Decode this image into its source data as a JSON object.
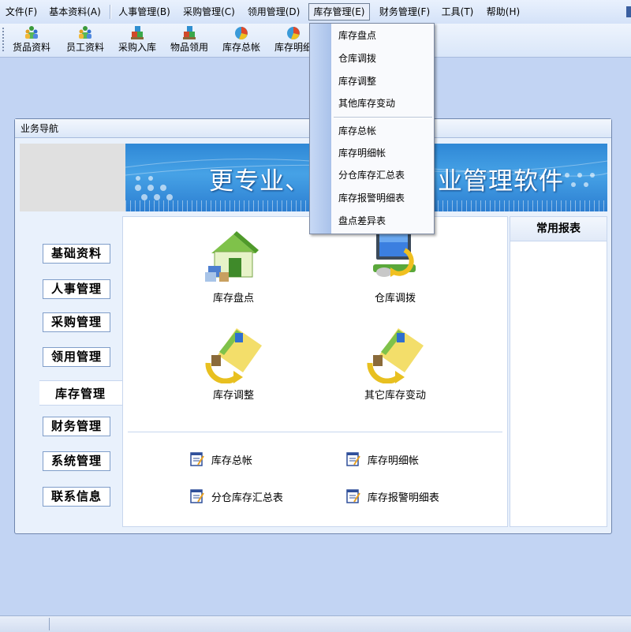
{
  "menubar": {
    "items": [
      {
        "label": "文件(F)"
      },
      {
        "label": "基本资料(A)"
      },
      {
        "label": "人事管理(B)"
      },
      {
        "label": "采购管理(C)"
      },
      {
        "label": "领用管理(D)"
      },
      {
        "label": "库存管理(E)"
      },
      {
        "label": "财务管理(F)"
      },
      {
        "label": "工具(T)"
      },
      {
        "label": "帮助(H)"
      }
    ]
  },
  "toolbar": {
    "buttons": [
      {
        "label": "货品资料",
        "icon": "people-icon"
      },
      {
        "label": "员工资料",
        "icon": "people-icon"
      },
      {
        "label": "采购入库",
        "icon": "boxes-icon"
      },
      {
        "label": "物品领用",
        "icon": "boxes-icon"
      },
      {
        "label": "库存总帐",
        "icon": "pie-chart-icon"
      },
      {
        "label": "库存明细",
        "icon": "pie-chart-icon"
      }
    ]
  },
  "dropdown": {
    "items": [
      {
        "label": "库存盘点"
      },
      {
        "label": "仓库调拨"
      },
      {
        "label": "库存调整"
      },
      {
        "label": "其他库存变动"
      },
      {
        "label": "库存总帐"
      },
      {
        "label": "库存明细帐"
      },
      {
        "label": "分仓库存汇总表"
      },
      {
        "label": "库存报警明细表"
      },
      {
        "label": "盘点差异表"
      }
    ]
  },
  "panel": {
    "title": "业务导航",
    "banner_text_left": "更专业、",
    "banner_text_right": "业管理软件"
  },
  "categories": [
    {
      "label": "基础资料"
    },
    {
      "label": "人事管理"
    },
    {
      "label": "采购管理"
    },
    {
      "label": "领用管理"
    },
    {
      "label": "库存管理"
    },
    {
      "label": "财务管理"
    },
    {
      "label": "系统管理"
    },
    {
      "label": "联系信息"
    }
  ],
  "main_items": [
    {
      "label": "库存盘点",
      "icon": "warehouse-icon"
    },
    {
      "label": "仓库调拨",
      "icon": "computer-transfer-icon"
    },
    {
      "label": "库存调整",
      "icon": "folder-arrow-icon"
    },
    {
      "label": "其它库存变动",
      "icon": "folder-arrow-icon"
    }
  ],
  "reports": [
    {
      "label": "库存总帐"
    },
    {
      "label": "库存明细帐"
    },
    {
      "label": "分仓库存汇总表"
    },
    {
      "label": "库存报警明细表"
    }
  ],
  "right_panel": {
    "title": "常用报表"
  },
  "colors": {
    "background": "#c2d4f3",
    "banner_blue": "#2f88d6",
    "accent_border": "#7f9dc9"
  }
}
